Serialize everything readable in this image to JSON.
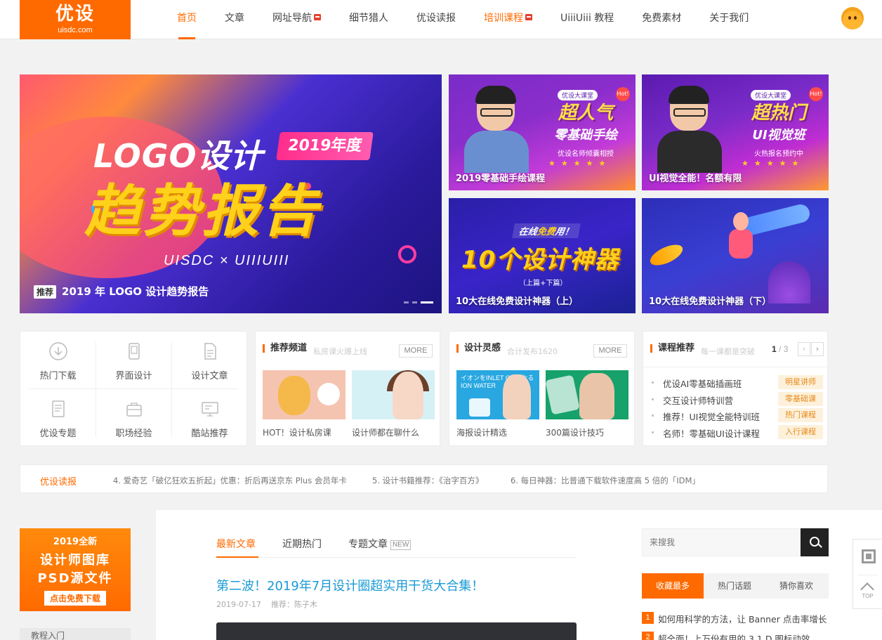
{
  "brand": {
    "logo_cn": "优设",
    "logo_en": "uisdc.com",
    "color": "#ff6a00"
  },
  "nav": {
    "items": [
      {
        "label": "首页",
        "active": true,
        "hot": false,
        "orange": false
      },
      {
        "label": "文章",
        "active": false,
        "hot": false,
        "orange": false
      },
      {
        "label": "网址导航",
        "active": false,
        "hot": true,
        "orange": false
      },
      {
        "label": "细节猎人",
        "active": false,
        "hot": false,
        "orange": false
      },
      {
        "label": "优设读报",
        "active": false,
        "hot": false,
        "orange": false
      },
      {
        "label": "培训课程",
        "active": false,
        "hot": true,
        "orange": true
      },
      {
        "label": "UiiiUiii 教程",
        "active": false,
        "hot": false,
        "orange": false
      },
      {
        "label": "免费素材",
        "active": false,
        "hot": false,
        "orange": false
      },
      {
        "label": "关于我们",
        "active": false,
        "hot": false,
        "orange": false
      }
    ]
  },
  "banner": {
    "logo_text": "LOGO设计",
    "year_text": "2019年度",
    "report_text": "趋势报告",
    "sub_text": "UISDC × UIIIUIII",
    "tag": "推荐",
    "caption": "2019 年 LOGO 设计趋势报告"
  },
  "tiles": [
    {
      "badge": "优设大课堂",
      "hot": "Hot!",
      "title1": "超人气",
      "title2": "零基础手绘",
      "sub": "优设名师倾囊相授",
      "stars": "★★★★★",
      "caption": "2019零基础手绘课程"
    },
    {
      "badge": "优设大课堂",
      "hot": "Hot!",
      "title1": "超热门",
      "title2": "UI视觉班",
      "sub": "火热报名预约中",
      "stars": "★★★★★",
      "caption": "UI视觉全能！名额有限"
    },
    {
      "free_pre": "在线",
      "free_word": "免费",
      "free_post": "用！",
      "big": "10个设计神器",
      "updn": "（上篇+下篇）",
      "caption": "10大在线免费设计神器（上）"
    },
    {
      "caption": "10大在线免费设计神器（下）"
    }
  ],
  "quick": [
    {
      "label": "热门下载",
      "icon": "download-icon"
    },
    {
      "label": "界面设计",
      "icon": "tablet-icon"
    },
    {
      "label": "设计文章",
      "icon": "document-icon"
    },
    {
      "label": "优设专题",
      "icon": "topic-icon"
    },
    {
      "label": "职场经验",
      "icon": "briefcase-icon"
    },
    {
      "label": "酷站推荐",
      "icon": "monitor-icon"
    }
  ],
  "panels": {
    "rec": {
      "title": "推荐频道",
      "sub": "私房课火爆上线",
      "more": "MORE",
      "items": [
        "HOT！设计私房课",
        "设计师都在聊什么"
      ]
    },
    "insp": {
      "title": "设计灵感",
      "sub": "合计发布1620",
      "more": "MORE",
      "items": [
        "海报设计精选",
        "300篇设计技巧"
      ],
      "thumb_text": "イオンをINLET ONになる ION WATER"
    },
    "course": {
      "title": "课程推荐",
      "sub": "每一课都是突破",
      "page": "1",
      "total": "/ 3",
      "items": [
        {
          "title": "优设AI零基础插画班",
          "badge": "明星讲师"
        },
        {
          "title": "交互设计师特训营",
          "badge": "零基础课"
        },
        {
          "title": "推荐！UI视觉全能特训班",
          "badge": "热门课程"
        },
        {
          "title": "名师！零基础UI设计课程",
          "badge": "入行课程"
        }
      ]
    }
  },
  "news": {
    "tag": "优设读报",
    "items": [
      "4. 爱奇艺「破亿狂欢五折起」优惠：折后再送京东 Plus 会员年卡",
      "5. 设计书籍推荐：《治字百方》",
      "6. 每日神器：比普通下载软件速度高 5 倍的「IDM」"
    ]
  },
  "promo": {
    "a": "2019全新",
    "b": "设计师图库",
    "c": "PSD源文件",
    "btn": "点击免费下载",
    "side": "教程入门"
  },
  "articles": {
    "tabs": [
      "最新文章",
      "近期热门",
      "专题文章"
    ],
    "new_badge": "NEW",
    "title": "第二波！2019年7月设计圈超实用干货大合集！",
    "date": "2019-07-17",
    "author": "推荐：陈子木"
  },
  "search": {
    "placeholder": "来搜我"
  },
  "right": {
    "tabs": [
      "收藏最多",
      "热门话题",
      "猜你喜欢"
    ],
    "ranks": [
      {
        "n": "1",
        "t": "如何用科学的方法，让 Banner 点击率增长"
      },
      {
        "n": "2",
        "t": "超全面！上万份有用的 3.1.D 图标动效"
      }
    ]
  },
  "float": {
    "top": "TOP"
  }
}
